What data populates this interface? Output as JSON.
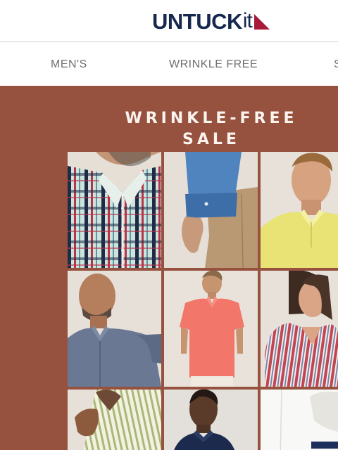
{
  "brand": {
    "name_main": "UNTUCK",
    "name_suffix": "it"
  },
  "nav": {
    "items": [
      {
        "label": "MEN'S"
      },
      {
        "label": "WRINKLE FREE"
      },
      {
        "label": "S"
      }
    ]
  },
  "hero": {
    "title": "WRINKLE-FREE SALE",
    "background": "#96523f"
  },
  "products": [
    {
      "name": "plaid-shirt-photo"
    },
    {
      "name": "blue-shirt-khaki-pants-photo"
    },
    {
      "name": "yellow-polo-photo"
    },
    {
      "name": "chambray-shirt-photo"
    },
    {
      "name": "coral-polo-photo"
    },
    {
      "name": "striped-blouse-photo"
    },
    {
      "name": "green-striped-shirt-photo"
    },
    {
      "name": "navy-shirt-photo"
    },
    {
      "name": "white-shirt-photo"
    }
  ]
}
